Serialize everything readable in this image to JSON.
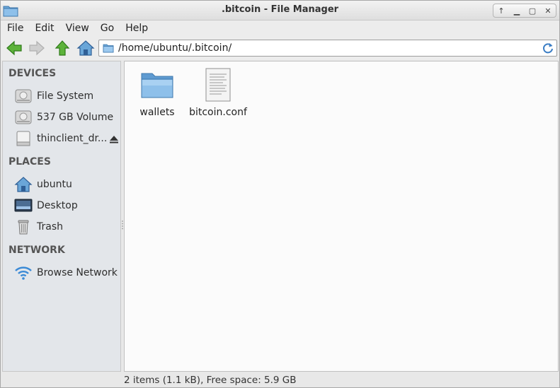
{
  "window": {
    "title": ".bitcoin - File Manager"
  },
  "menubar": {
    "items": [
      "File",
      "Edit",
      "View",
      "Go",
      "Help"
    ]
  },
  "toolbar": {
    "location": "/home/ubuntu/.bitcoin/"
  },
  "sidebar": {
    "devices": {
      "header": "DEVICES",
      "items": [
        {
          "label": "File System",
          "icon": "harddisk-icon"
        },
        {
          "label": "537 GB Volume",
          "icon": "harddisk-icon"
        },
        {
          "label": "thinclient_dr...",
          "icon": "drive-icon"
        }
      ]
    },
    "places": {
      "header": "PLACES",
      "items": [
        {
          "label": "ubuntu",
          "icon": "home-icon"
        },
        {
          "label": "Desktop",
          "icon": "desktop-icon"
        },
        {
          "label": "Trash",
          "icon": "trash-icon"
        }
      ]
    },
    "network": {
      "header": "NETWORK",
      "items": [
        {
          "label": "Browse Network",
          "icon": "wifi-icon"
        }
      ]
    }
  },
  "files": [
    {
      "name": "wallets",
      "type": "folder"
    },
    {
      "name": "bitcoin.conf",
      "type": "text-file"
    }
  ],
  "status": {
    "text": "2 items (1.1 kB), Free space: 5.9 GB"
  },
  "colors": {
    "folder": "#6aa6d8",
    "accent": "#3b7dc4",
    "nav_green": "#4aa02c"
  }
}
